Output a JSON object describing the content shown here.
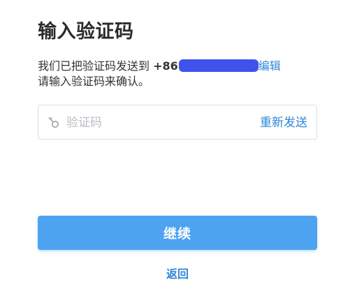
{
  "title": "输入验证码",
  "description": {
    "prefix": "我们已把验证码发送到 ",
    "phone_prefix": "+86",
    "edit_link": "编辑",
    "line2": "请输入验证码来确认。"
  },
  "code_field": {
    "placeholder": "验证码",
    "value": "",
    "icon": "key-icon",
    "resend_label": "重新发送"
  },
  "continue_button": {
    "label": "继续"
  },
  "back_link": {
    "label": "返回"
  },
  "colors": {
    "primary": "#4ea3f1",
    "link": "#2f86d8",
    "mask": "#3f52ec",
    "text": "#2b2b2b",
    "border": "#d9dde2"
  }
}
